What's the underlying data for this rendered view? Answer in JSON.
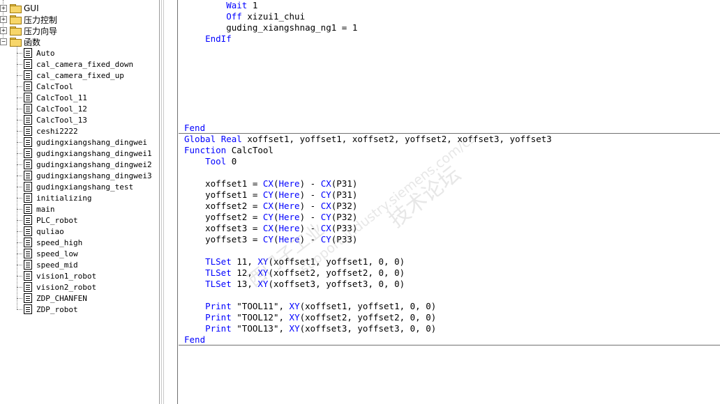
{
  "tree": {
    "folders": [
      {
        "label": "GUI",
        "expanded": false
      },
      {
        "label": "压力控制",
        "expanded": false
      },
      {
        "label": "压力向导",
        "expanded": false
      },
      {
        "label": "函数",
        "expanded": true
      }
    ],
    "functions": [
      "Auto",
      "cal_camera_fixed_down",
      "cal_camera_fixed_up",
      "CalcTool",
      "CalcTool_11",
      "CalcTool_12",
      "CalcTool_13",
      "ceshi2222",
      "gudingxiangshang_dingwei",
      "gudingxiangshang_dingwei1",
      "gudingxiangshang_dingwei2",
      "gudingxiangshang_dingwei3",
      "gudingxiangshang_test",
      "initializing",
      "main",
      "PLC_robot",
      "quliao",
      "speed_high",
      "speed_low",
      "speed_mid",
      "vision1_robot",
      "vision2_robot",
      "ZDP_CHANFEN",
      "ZDP_robot"
    ]
  },
  "editor": {
    "top_lines": [
      [
        {
          "t": "        "
        },
        {
          "t": "Wait",
          "k": 1
        },
        {
          "t": " 1"
        }
      ],
      [
        {
          "t": "        "
        },
        {
          "t": "Off",
          "k": 1
        },
        {
          "t": " xizui1_chui"
        }
      ],
      [
        {
          "t": "        guding_xiangshnag_ng1 = 1"
        }
      ],
      [
        {
          "t": "    "
        },
        {
          "t": "EndIf",
          "k": 1
        }
      ],
      [
        {
          "t": ""
        }
      ],
      [
        {
          "t": ""
        }
      ],
      [
        {
          "t": ""
        }
      ],
      [
        {
          "t": ""
        }
      ],
      [
        {
          "t": ""
        }
      ],
      [
        {
          "t": ""
        }
      ],
      [
        {
          "t": ""
        }
      ],
      [
        {
          "t": "Fend",
          "k": 1
        }
      ]
    ],
    "bottom_lines": [
      [
        {
          "t": "Global",
          "k": 1
        },
        {
          "t": " "
        },
        {
          "t": "Real",
          "k": 1
        },
        {
          "t": " xoffset1, yoffset1, xoffset2, yoffset2, xoffset3, yoffset3"
        }
      ],
      [
        {
          "t": "Function",
          "k": 1
        },
        {
          "t": " CalcTool"
        }
      ],
      [
        {
          "t": "    "
        },
        {
          "t": "Tool",
          "k": 1
        },
        {
          "t": " 0"
        }
      ],
      [
        {
          "t": ""
        }
      ],
      [
        {
          "t": "    xoffset1 = "
        },
        {
          "t": "CX",
          "k": 1
        },
        {
          "t": "("
        },
        {
          "t": "Here",
          "k": 1
        },
        {
          "t": ") - "
        },
        {
          "t": "CX",
          "k": 1
        },
        {
          "t": "(P31)"
        }
      ],
      [
        {
          "t": "    yoffset1 = "
        },
        {
          "t": "CY",
          "k": 1
        },
        {
          "t": "("
        },
        {
          "t": "Here",
          "k": 1
        },
        {
          "t": ") - "
        },
        {
          "t": "CY",
          "k": 1
        },
        {
          "t": "(P31)"
        }
      ],
      [
        {
          "t": "    xoffset2 = "
        },
        {
          "t": "CX",
          "k": 1
        },
        {
          "t": "("
        },
        {
          "t": "Here",
          "k": 1
        },
        {
          "t": ") - "
        },
        {
          "t": "CX",
          "k": 1
        },
        {
          "t": "(P32)"
        }
      ],
      [
        {
          "t": "    yoffset2 = "
        },
        {
          "t": "CY",
          "k": 1
        },
        {
          "t": "("
        },
        {
          "t": "Here",
          "k": 1
        },
        {
          "t": ") - "
        },
        {
          "t": "CY",
          "k": 1
        },
        {
          "t": "(P32)"
        }
      ],
      [
        {
          "t": "    xoffset3 = "
        },
        {
          "t": "CX",
          "k": 1
        },
        {
          "t": "("
        },
        {
          "t": "Here",
          "k": 1
        },
        {
          "t": ") - "
        },
        {
          "t": "CX",
          "k": 1
        },
        {
          "t": "(P33)"
        }
      ],
      [
        {
          "t": "    yoffset3 = "
        },
        {
          "t": "CY",
          "k": 1
        },
        {
          "t": "("
        },
        {
          "t": "Here",
          "k": 1
        },
        {
          "t": ") - "
        },
        {
          "t": "CY",
          "k": 1
        },
        {
          "t": "(P33)"
        }
      ],
      [
        {
          "t": ""
        }
      ],
      [
        {
          "t": "    "
        },
        {
          "t": "TLSet",
          "k": 1
        },
        {
          "t": " 11, "
        },
        {
          "t": "XY",
          "k": 1
        },
        {
          "t": "(xoffset1, yoffset1, 0, 0)"
        }
      ],
      [
        {
          "t": "    "
        },
        {
          "t": "TLSet",
          "k": 1
        },
        {
          "t": " 12, "
        },
        {
          "t": "XY",
          "k": 1
        },
        {
          "t": "(xoffset2, yoffset2, 0, 0)"
        }
      ],
      [
        {
          "t": "    "
        },
        {
          "t": "TLSet",
          "k": 1
        },
        {
          "t": " 13, "
        },
        {
          "t": "XY",
          "k": 1
        },
        {
          "t": "(xoffset3, yoffset3, 0, 0)"
        }
      ],
      [
        {
          "t": ""
        }
      ],
      [
        {
          "t": "    "
        },
        {
          "t": "Print",
          "k": 1
        },
        {
          "t": " \"TOOL11\", "
        },
        {
          "t": "XY",
          "k": 1
        },
        {
          "t": "(xoffset1, yoffset1, 0, 0)"
        }
      ],
      [
        {
          "t": "    "
        },
        {
          "t": "Print",
          "k": 1
        },
        {
          "t": " \"TOOL12\", "
        },
        {
          "t": "XY",
          "k": 1
        },
        {
          "t": "(xoffset2, yoffset2, 0, 0)"
        }
      ],
      [
        {
          "t": "    "
        },
        {
          "t": "Print",
          "k": 1
        },
        {
          "t": " \"TOOL13\", "
        },
        {
          "t": "XY",
          "k": 1
        },
        {
          "t": "(xoffset3, yoffset3, 0, 0)"
        }
      ],
      [
        {
          "t": "Fend",
          "k": 1
        }
      ]
    ]
  },
  "watermark": {
    "line1": "技术论坛",
    "line2": "support.industry.siemens.com/cs",
    "line3": "西门子工业"
  },
  "colors": {
    "keyword": "#0000ff",
    "text": "#000000"
  }
}
